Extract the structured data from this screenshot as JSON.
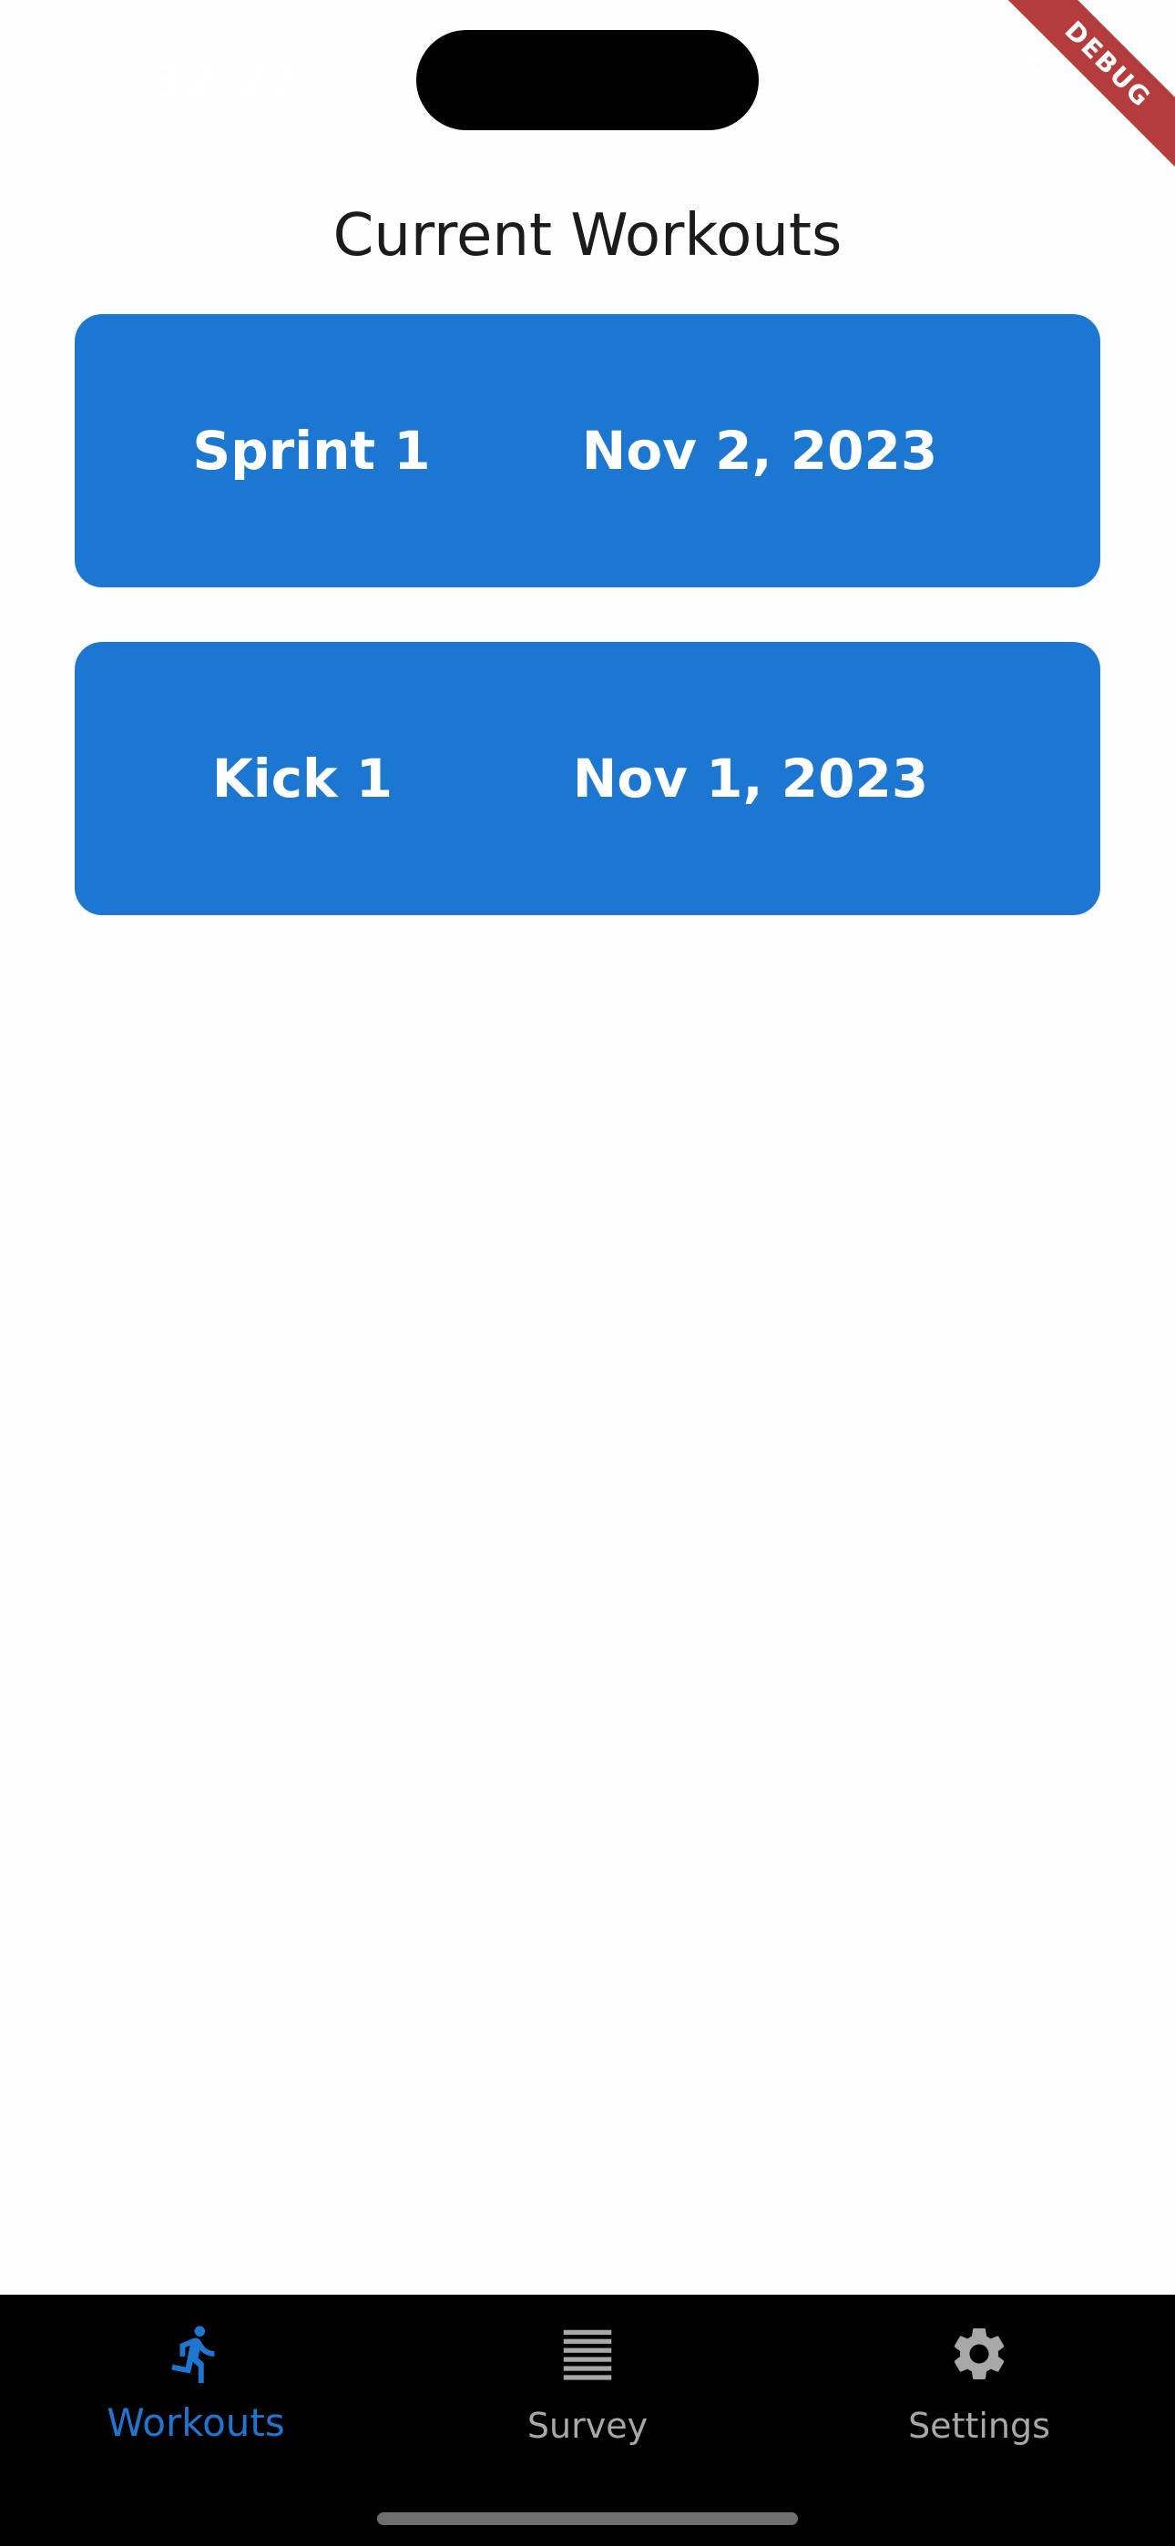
{
  "status_bar": {
    "time": "12:27"
  },
  "debug_banner": {
    "label": "DEBUG"
  },
  "page": {
    "title": "Current Workouts"
  },
  "workouts": [
    {
      "name": "Sprint 1",
      "date": "Nov 2, 2023"
    },
    {
      "name": "Kick 1",
      "date": "Nov 1, 2023"
    }
  ],
  "bottom_nav": {
    "items": [
      {
        "label": "Workouts",
        "icon": "running-person-icon",
        "active": true
      },
      {
        "label": "Survey",
        "icon": "list-lines-icon",
        "active": false
      },
      {
        "label": "Settings",
        "icon": "gear-icon",
        "active": false
      }
    ]
  },
  "colors": {
    "card_background": "#1b77d2",
    "active_tab": "#1b77d2",
    "inactive_tab": "#a8a8a8",
    "nav_background": "#000000",
    "page_background": "#fefefe",
    "debug_ribbon": "#b43c3c"
  }
}
